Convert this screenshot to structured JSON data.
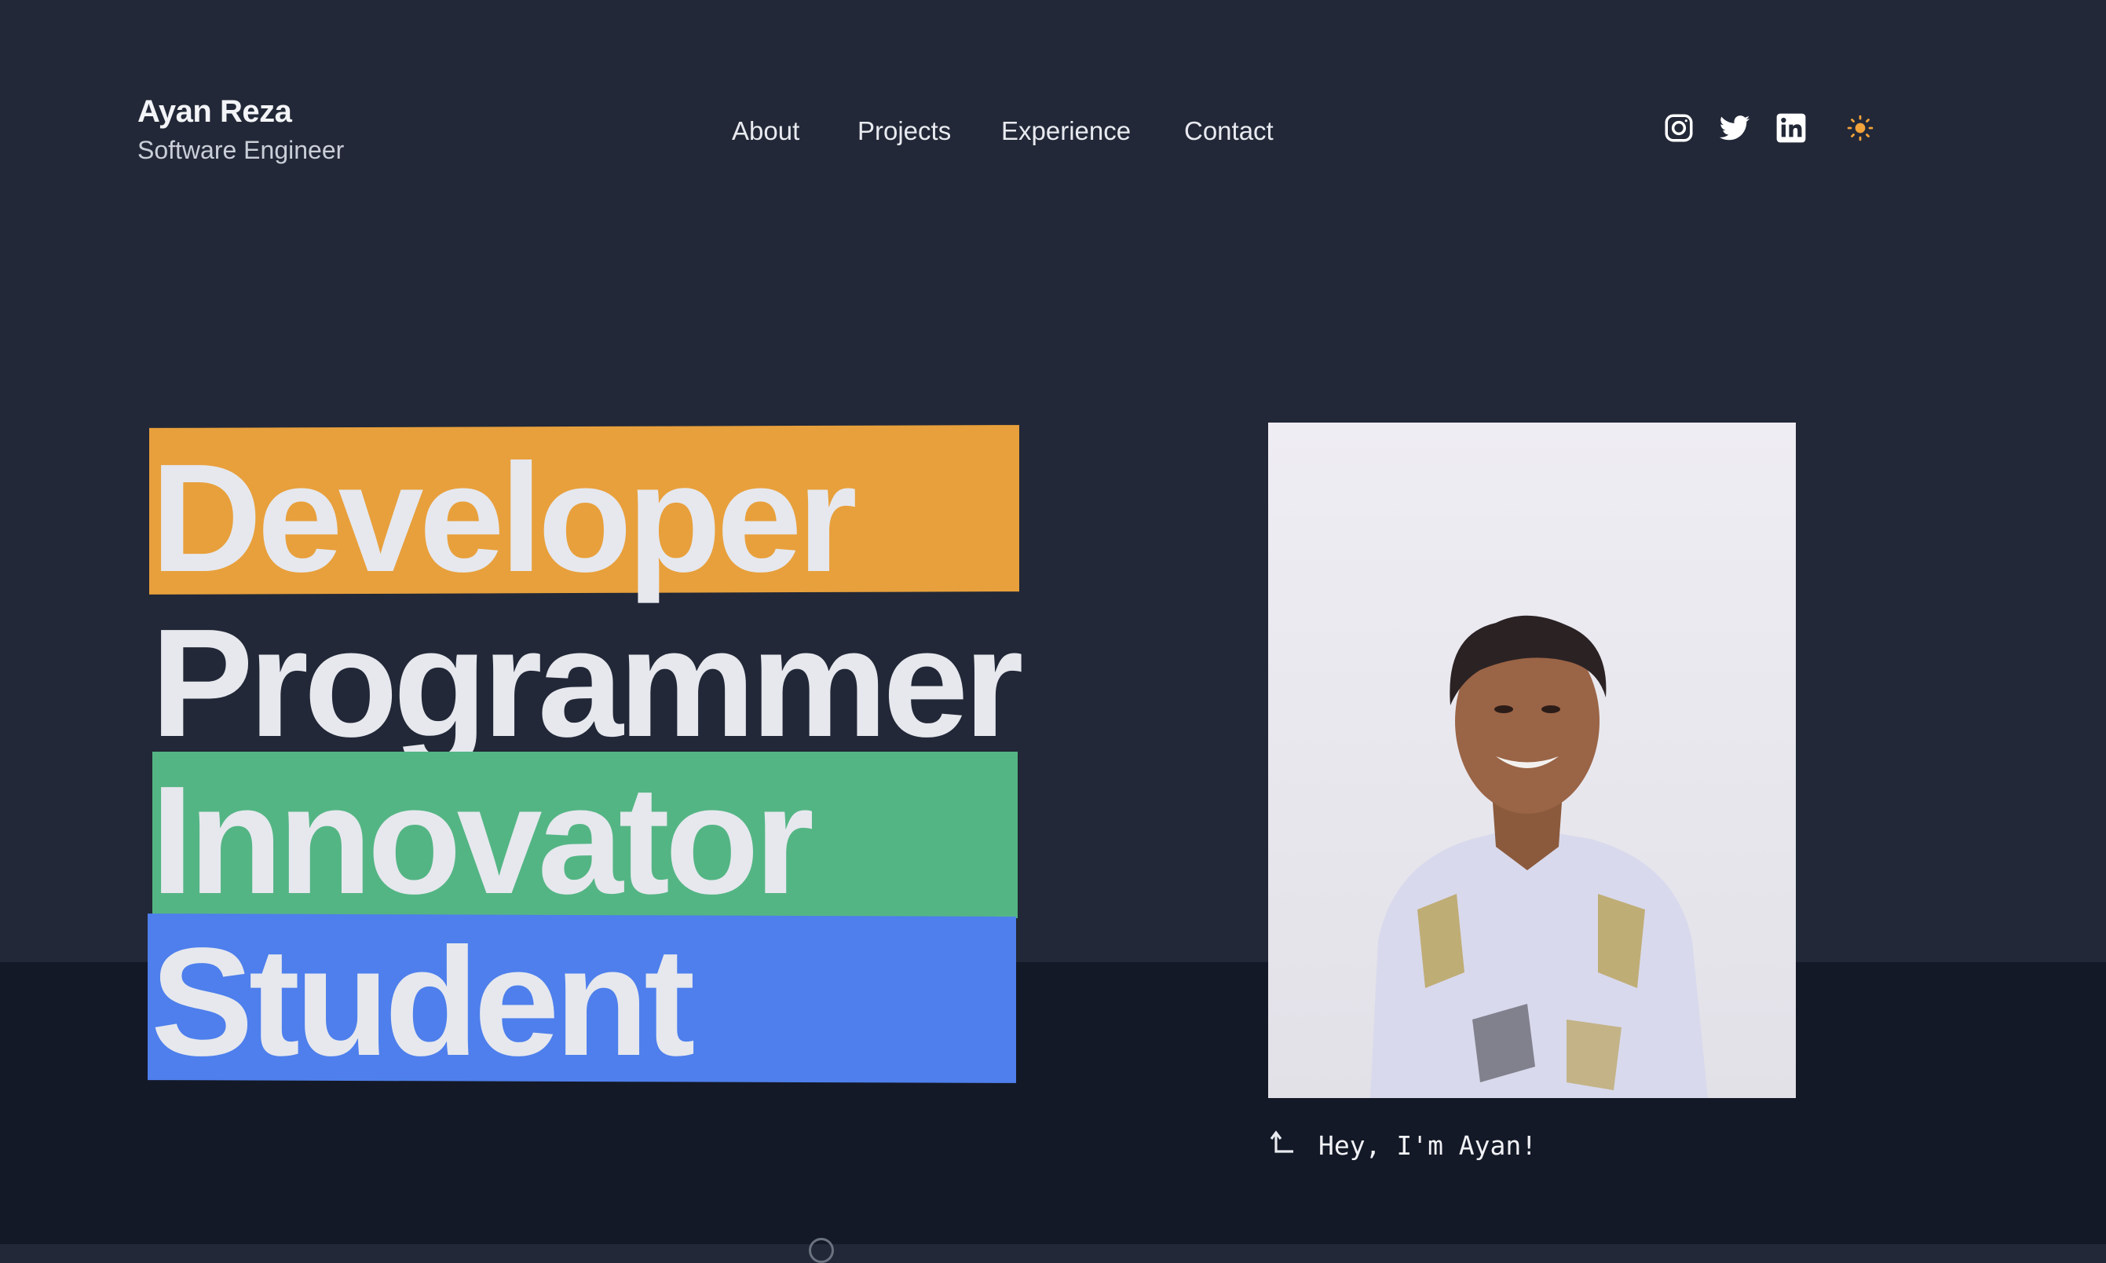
{
  "header": {
    "name": "Ayan Reza",
    "role": "Software Engineer"
  },
  "nav": {
    "items": [
      "About",
      "Projects",
      "Experience",
      "Contact"
    ]
  },
  "social": {
    "icons": [
      "instagram-icon",
      "twitter-icon",
      "linkedin-icon"
    ],
    "theme_icon": "sun-icon"
  },
  "hero": {
    "words": [
      "Developer",
      "Programmer",
      "Innovator",
      "Student"
    ],
    "highlight_colors": [
      "#E8A03C",
      "",
      "#54B584",
      "#4E7FEC"
    ]
  },
  "photo": {
    "caption": "Hey, I'm Ayan!"
  },
  "colors": {
    "background": "#222837",
    "background_lower": "#141927",
    "accent_sun": "#F2A33A"
  }
}
